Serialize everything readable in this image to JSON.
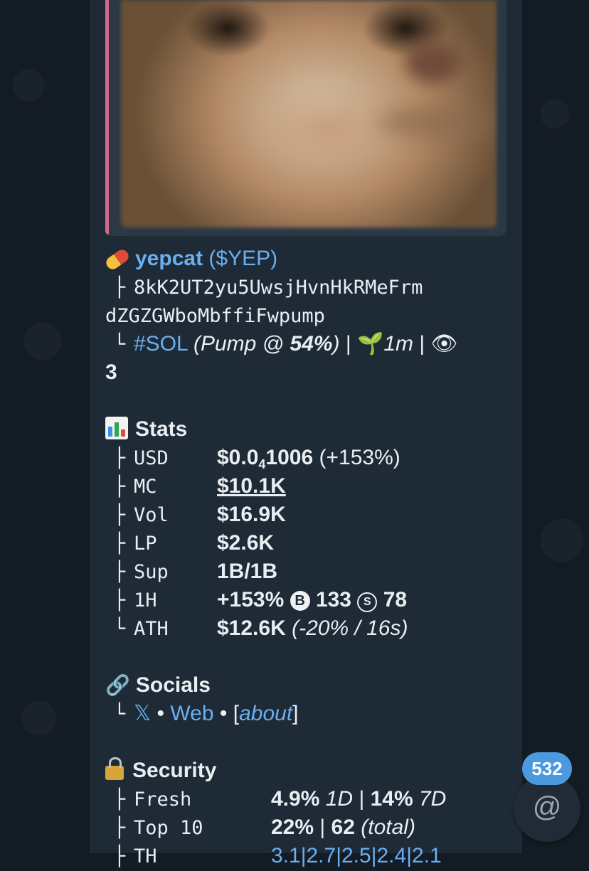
{
  "token": {
    "name": "yepcat",
    "ticker": "($YEP)",
    "address_line1": "8kK2UT2yu5UwsjHvnHkRMeFrm",
    "address_line2": "dZGZGWboMbffiFwpump",
    "chain_tag": "#SOL",
    "pump_status": "(Pump @ ",
    "pump_percent": "54%",
    "pump_close": ")",
    "age": "1m",
    "watchers": "3",
    "separator": "|"
  },
  "stats": {
    "heading": "Stats",
    "rows": [
      {
        "key": "USD",
        "value": "$0.0",
        "sub": "4",
        "value_rest": "1006",
        "extra": "(+153%)"
      },
      {
        "key": "MC",
        "value": "$10.1K"
      },
      {
        "key": "Vol",
        "value": "$16.9K"
      },
      {
        "key": "LP",
        "value": "$2.6K"
      },
      {
        "key": "Sup",
        "value": "1B/1B"
      },
      {
        "key": "1H",
        "value": "+153%",
        "buys": "133",
        "sells": "78",
        "buy_symbol": "B",
        "sell_symbol": "S"
      },
      {
        "key": "ATH",
        "value": "$12.6K",
        "extra": "(-20% / 16s)"
      }
    ]
  },
  "socials": {
    "heading": "Socials",
    "x": "𝕏",
    "dot": "•",
    "web": "Web",
    "bracket_open": "[",
    "about": "about",
    "bracket_close": "]"
  },
  "security": {
    "heading": "Security",
    "rows": [
      {
        "key": "Fresh",
        "v1": "4.9%",
        "p1": "1D",
        "v2": "14%",
        "p2": "7D"
      },
      {
        "key": "Top 10",
        "v1": "22%",
        "v2": "62",
        "p2": "(total)"
      },
      {
        "key": "TH",
        "v1": "3.1|2.7|2.5|2.4|2.1"
      }
    ]
  },
  "tree": {
    "branch": "├",
    "end": "└"
  },
  "unread_badge": "532",
  "mention_symbol": "@",
  "icons": [
    "pill-icon",
    "seedling-icon",
    "eye-icon",
    "bar-chart-icon",
    "link-icon",
    "lock-icon"
  ],
  "colors": {
    "link": "#6aaff0",
    "bubble": "#1e2a36",
    "background": "#131b24",
    "badge": "#4b9ae0",
    "accent": "#d46a8a"
  }
}
